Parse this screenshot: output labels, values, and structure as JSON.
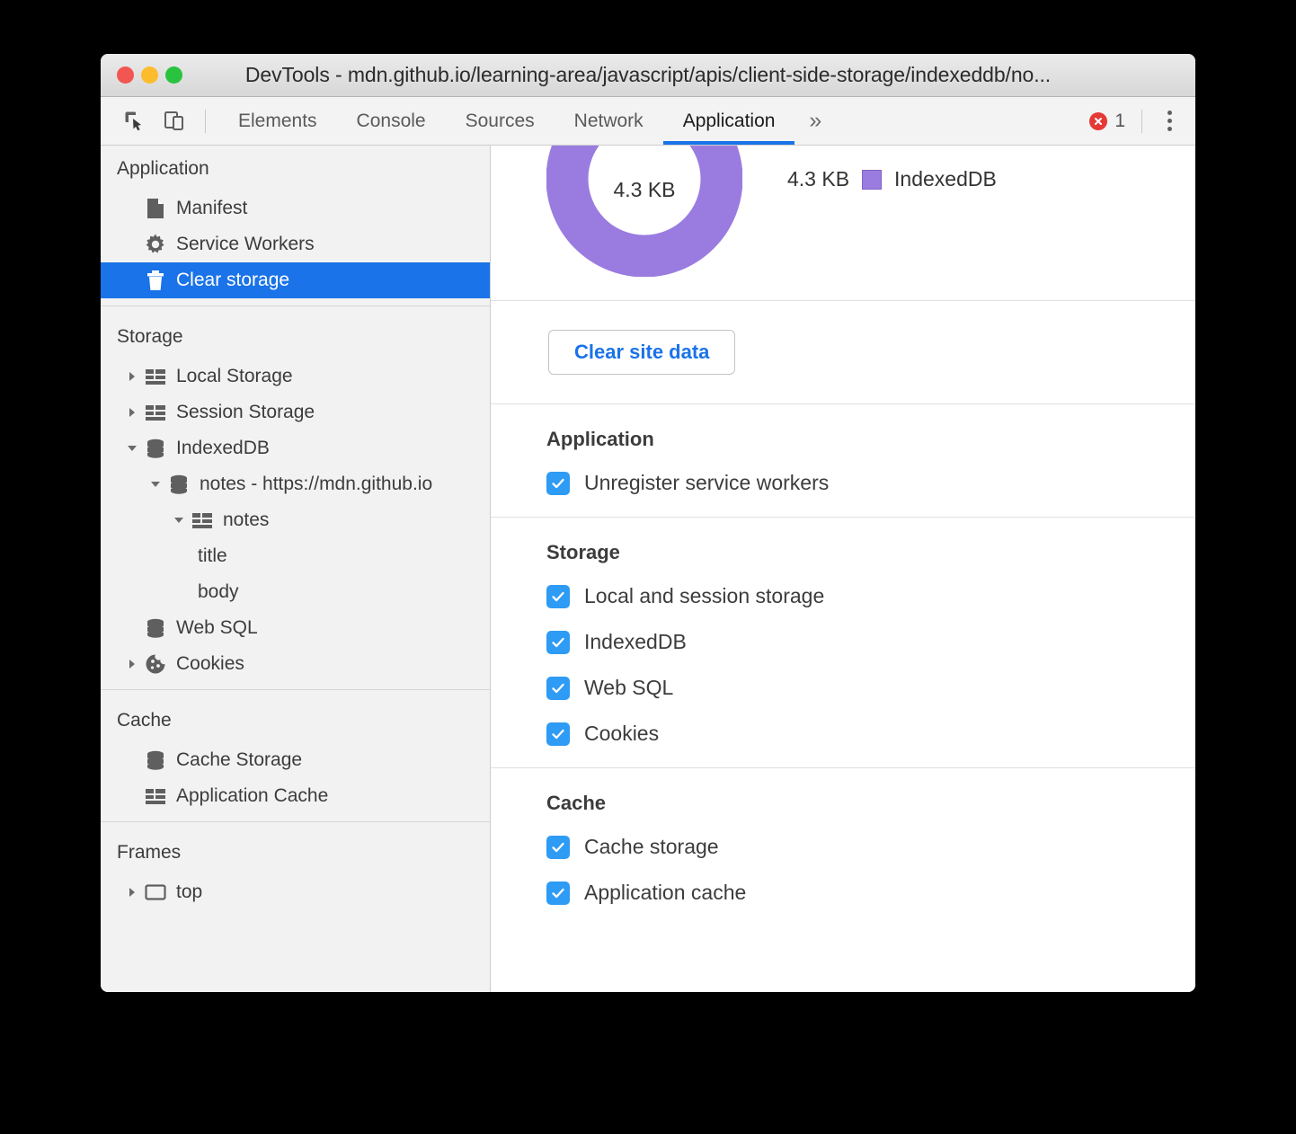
{
  "window": {
    "title": "DevTools - mdn.github.io/learning-area/javascript/apis/client-side-storage/indexeddb/no..."
  },
  "toolbar": {
    "inspect_icon": "inspect-element-icon",
    "device_icon": "device-toolbar-icon",
    "tabs": [
      {
        "label": "Elements",
        "active": false
      },
      {
        "label": "Console",
        "active": false
      },
      {
        "label": "Sources",
        "active": false
      },
      {
        "label": "Network",
        "active": false
      },
      {
        "label": "Application",
        "active": true
      }
    ],
    "overflow_label": "»",
    "error_count": "1",
    "error_icon": "error-circle-icon",
    "menu_icon": "kebab-menu-icon"
  },
  "sidebar": {
    "sections": [
      {
        "header": "Application",
        "items": [
          {
            "label": "Manifest",
            "icon": "document-icon",
            "indent": 1,
            "twisty": "none",
            "selected": false
          },
          {
            "label": "Service Workers",
            "icon": "gear-icon",
            "indent": 1,
            "twisty": "none",
            "selected": false
          },
          {
            "label": "Clear storage",
            "icon": "trash-icon",
            "indent": 1,
            "twisty": "none",
            "selected": true
          }
        ]
      },
      {
        "header": "Storage",
        "items": [
          {
            "label": "Local Storage",
            "icon": "table-icon",
            "indent": 1,
            "twisty": "collapsed",
            "selected": false
          },
          {
            "label": "Session Storage",
            "icon": "table-icon",
            "indent": 1,
            "twisty": "collapsed",
            "selected": false
          },
          {
            "label": "IndexedDB",
            "icon": "database-icon",
            "indent": 1,
            "twisty": "expanded",
            "selected": false
          },
          {
            "label": "notes - https://mdn.github.io",
            "icon": "database-icon",
            "indent": 2,
            "twisty": "expanded",
            "selected": false
          },
          {
            "label": "notes",
            "icon": "table-icon",
            "indent": 3,
            "twisty": "expanded",
            "selected": false
          },
          {
            "label": "title",
            "icon": "none",
            "indent": 4,
            "twisty": "none",
            "selected": false
          },
          {
            "label": "body",
            "icon": "none",
            "indent": 4,
            "twisty": "none",
            "selected": false
          },
          {
            "label": "Web SQL",
            "icon": "database-icon",
            "indent": 1,
            "twisty": "none",
            "selected": false
          },
          {
            "label": "Cookies",
            "icon": "cookie-icon",
            "indent": 1,
            "twisty": "collapsed",
            "selected": false
          }
        ]
      },
      {
        "header": "Cache",
        "items": [
          {
            "label": "Cache Storage",
            "icon": "database-icon",
            "indent": 1,
            "twisty": "none",
            "selected": false
          },
          {
            "label": "Application Cache",
            "icon": "table-icon",
            "indent": 1,
            "twisty": "none",
            "selected": false
          }
        ]
      },
      {
        "header": "Frames",
        "items": [
          {
            "label": "top",
            "icon": "frame-icon",
            "indent": 1,
            "twisty": "collapsed",
            "selected": false
          }
        ]
      }
    ]
  },
  "main": {
    "usage": {
      "center_label": "4.3 KB",
      "legend_value": "4.3 KB",
      "legend_label": "IndexedDB",
      "legend_color": "#9a7ce0"
    },
    "clear_button": "Clear site data",
    "groups": [
      {
        "title": "Application",
        "options": [
          {
            "label": "Unregister service workers",
            "checked": true
          }
        ]
      },
      {
        "title": "Storage",
        "options": [
          {
            "label": "Local and session storage",
            "checked": true
          },
          {
            "label": "IndexedDB",
            "checked": true
          },
          {
            "label": "Web SQL",
            "checked": true
          },
          {
            "label": "Cookies",
            "checked": true
          }
        ]
      },
      {
        "title": "Cache",
        "options": [
          {
            "label": "Cache storage",
            "checked": true
          },
          {
            "label": "Application cache",
            "checked": true
          }
        ]
      }
    ]
  },
  "chart_data": {
    "type": "pie",
    "title": "",
    "categories": [
      "IndexedDB"
    ],
    "values": [
      4.3
    ],
    "value_labels": [
      "4.3 KB"
    ],
    "total_label": "4.3 KB",
    "unit": "KB",
    "colors": [
      "#9a7ce0"
    ],
    "legend_position": "right",
    "donut": true
  }
}
